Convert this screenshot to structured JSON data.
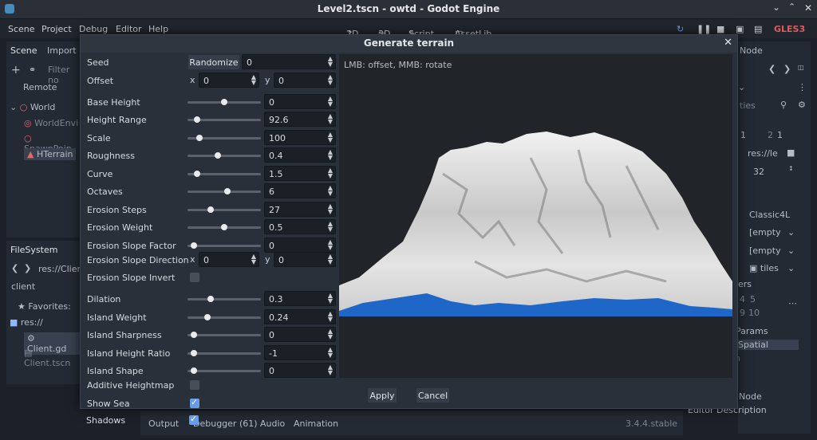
{
  "window": {
    "title": "Level2.tscn - owtd - Godot Engine"
  },
  "menu": {
    "items": [
      "Scene",
      "Project",
      "Debug",
      "Editor",
      "Help"
    ]
  },
  "workspaces": {
    "w2d": "2D",
    "w3d": "3D",
    "script": "Script",
    "assetlib": "AssetLib"
  },
  "renderer": "GLES3",
  "scene_dock": {
    "tab_scene": "Scene",
    "tab_import": "Import",
    "filter_placeholder": "Filter no",
    "remote": "Remote",
    "tree": [
      "World",
      "WorldEnvi",
      "SpawnPoin",
      "HTerrain"
    ]
  },
  "filesystem": {
    "tab": "FileSystem",
    "path": "res://Client",
    "search": "client",
    "favorites": "Favorites:",
    "res": "res://",
    "files": [
      "Client.gd",
      "Client.tscn"
    ]
  },
  "inspector": {
    "node_tab": "Node",
    "ties": "ties",
    "val1": "1",
    "val2": "2",
    "val3": "1",
    "res_le": "res://le",
    "val32": "32",
    "classic": "Classic4L",
    "empty1": "[empty",
    "empty2": "[empty",
    "tiles": "tiles",
    "ers": "ers",
    "nums_a": [
      "4",
      "5"
    ],
    "nums_b": [
      "9",
      "10"
    ],
    "params": "Params",
    "spatial": "Spatial",
    "node_btn": "Node",
    "editor_desc": "Editor Description"
  },
  "bottom": {
    "tabs": [
      "Output",
      "Debugger (61)",
      "Audio",
      "Animation"
    ],
    "version": "3.4.4.stable"
  },
  "dialog": {
    "title": "Generate terrain",
    "preview_hint": "LMB: offset, MMB: rotate",
    "randomize": "Randomize",
    "seed_value": "0",
    "x": "x",
    "y": "y",
    "offset": {
      "x": "0",
      "y": "0"
    },
    "slope_dir": {
      "x": "0",
      "y": "0"
    },
    "labels": {
      "seed": "Seed",
      "offset": "Offset",
      "base_height": "Base Height",
      "height_range": "Height Range",
      "scale": "Scale",
      "roughness": "Roughness",
      "curve": "Curve",
      "octaves": "Octaves",
      "erosion_steps": "Erosion Steps",
      "erosion_weight": "Erosion Weight",
      "erosion_slope_factor": "Erosion Slope Factor",
      "erosion_slope_direction": "Erosion Slope Direction",
      "erosion_slope_invert": "Erosion Slope Invert",
      "dilation": "Dilation",
      "island_weight": "Island Weight",
      "island_sharpness": "Island Sharpness",
      "island_height_ratio": "Island Height Ratio",
      "island_shape": "Island Shape",
      "additive_heightmap": "Additive Heightmap",
      "show_sea": "Show Sea",
      "shadows": "Shadows"
    },
    "values": {
      "base_height": "0",
      "height_range": "92.6",
      "scale": "100",
      "roughness": "0.4",
      "curve": "1.5",
      "octaves": "6",
      "erosion_steps": "27",
      "erosion_weight": "0.5",
      "erosion_slope_factor": "0",
      "dilation": "0.3",
      "island_weight": "0.24",
      "island_sharpness": "0",
      "island_height_ratio": "-1",
      "island_shape": "0"
    },
    "slider_fraction": {
      "base_height": 0.5,
      "height_range": 0.1,
      "scale": 0.13,
      "roughness": 0.4,
      "curve": 0.1,
      "octaves": 0.55,
      "erosion_steps": 0.3,
      "erosion_weight": 0.5,
      "erosion_slope_factor": 0.05,
      "dilation": 0.3,
      "island_weight": 0.25,
      "island_sharpness": 0.05,
      "island_height_ratio": 0.05,
      "island_shape": 0.05
    },
    "checks": {
      "erosion_slope_invert": false,
      "additive_heightmap": false,
      "show_sea": true,
      "shadows": true
    },
    "apply": "Apply",
    "cancel": "Cancel"
  },
  "colors": {
    "accent": "#699ce8",
    "sea": "#1f66c9"
  }
}
